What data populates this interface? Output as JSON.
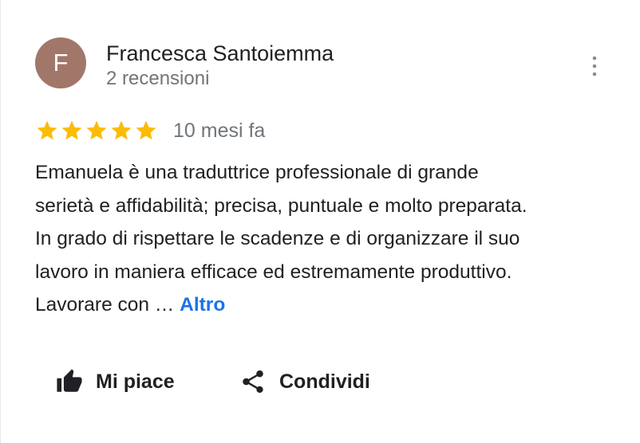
{
  "review": {
    "avatar_initial": "F",
    "avatar_color": "#a1776a",
    "reviewer_name": "Francesca Santoiemma",
    "review_count": "2 recensioni",
    "rating": 5,
    "rating_max": 5,
    "star_color": "#fbbc04",
    "date": "10 mesi fa",
    "text_lines": [
      "Emanuela è una traduttrice professionale di grande",
      "serietà e affidabilità; precisa, puntuale e molto preparata.",
      "In grado di rispettare le scadenze e di organizzare il suo",
      "lavoro in maniera efficace ed estremamente produttivo.",
      "Lavorare con … "
    ],
    "more_link": "Altro",
    "more_link_color": "#1a73e8",
    "menu_icon": "more-vert-icon"
  },
  "actions": {
    "like_label": "Mi piace",
    "like_icon": "thumb-up-icon",
    "share_label": "Condividi",
    "share_icon": "share-icon"
  }
}
